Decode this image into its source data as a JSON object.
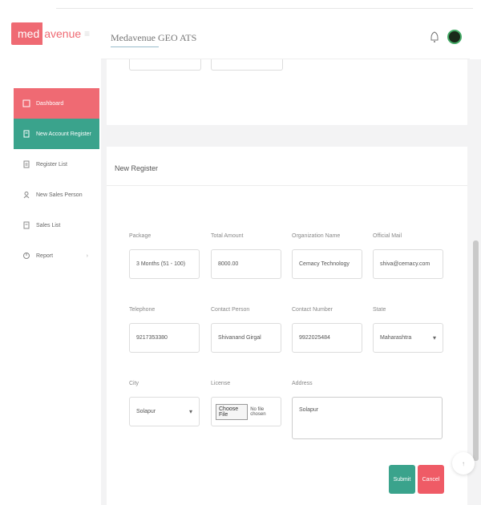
{
  "brand": {
    "logo_box": "med",
    "logo_rest": "avenue",
    "logo_mark": "≡"
  },
  "header": {
    "title": "Medavenue GEO ATS"
  },
  "sidebar": {
    "items": [
      {
        "label": "Dashboard",
        "icon": "dashboard-icon"
      },
      {
        "label": "New Account Register",
        "icon": "document-icon"
      },
      {
        "label": "Register List",
        "icon": "list-icon"
      },
      {
        "label": "New Sales Person",
        "icon": "user-icon"
      },
      {
        "label": "Sales List",
        "icon": "list-icon"
      },
      {
        "label": "Report",
        "icon": "report-icon",
        "chevron": "›"
      }
    ]
  },
  "form": {
    "title": "New Register",
    "fields": {
      "package": {
        "label": "Package",
        "value": "3 Months (51 - 100)"
      },
      "total_amount": {
        "label": "Total Amount",
        "value": "8000.00"
      },
      "organization": {
        "label": "Organization Name",
        "value": "Cemacy Technology"
      },
      "official_mail": {
        "label": "Official Mail",
        "value": "shiva@cemacy.com"
      },
      "telephone": {
        "label": "Telephone",
        "value": "9217353380"
      },
      "contact_person": {
        "label": "Contact Person",
        "value": "Shivanand Girgal"
      },
      "contact_number": {
        "label": "Contact Number",
        "value": "9922025484"
      },
      "state": {
        "label": "State",
        "value": "Maharashtra"
      },
      "city": {
        "label": "City",
        "value": "Solapur"
      },
      "license": {
        "label": "License",
        "button": "Choose File",
        "status": "No file chosen"
      },
      "address": {
        "label": "Address",
        "value": "Solapur"
      }
    },
    "submit": "Submit",
    "cancel": "Cancel"
  },
  "colors": {
    "accent_red": "#ef6a73",
    "accent_green": "#3aa38c"
  }
}
